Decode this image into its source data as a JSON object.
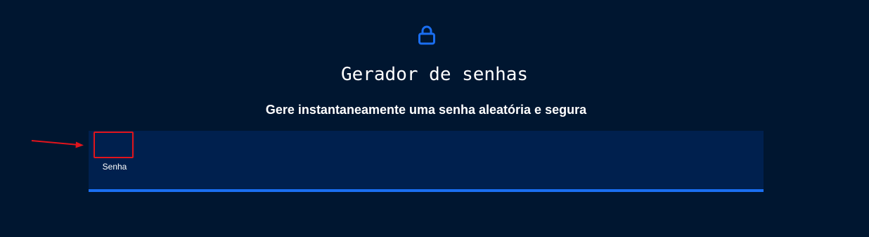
{
  "header": {
    "icon": "lock-icon",
    "title": "Gerador de senhas",
    "subtitle": "Gere instantaneamente uma senha aleatória e segura"
  },
  "generator": {
    "password_label": "Senha",
    "password_value": ""
  },
  "annotation": {
    "arrow_icon": "red-arrow-icon",
    "highlight_color": "#e2141c"
  },
  "colors": {
    "background": "#001630",
    "panel": "#00204e",
    "accent": "#1a6ef0",
    "text": "#ffffff"
  }
}
